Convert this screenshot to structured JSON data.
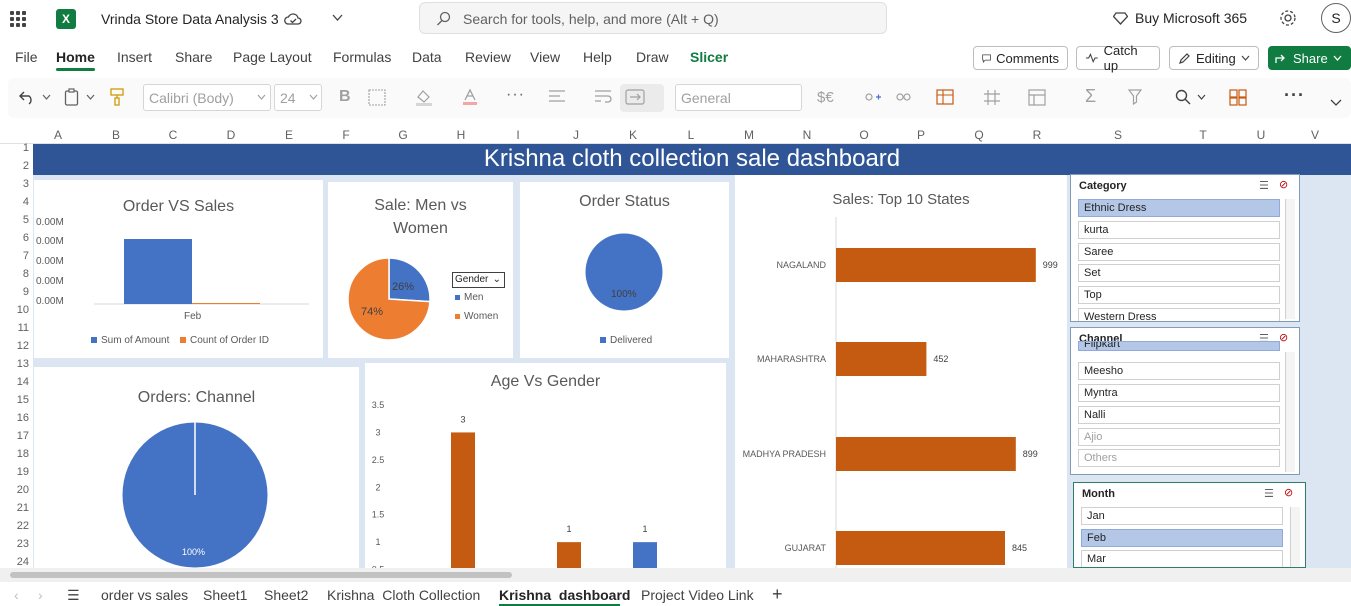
{
  "app": {
    "doc_title": "Vrinda Store Data Analysis 3",
    "search_placeholder": "Search for tools, help, and more (Alt + Q)",
    "buy_label": "Buy Microsoft 365",
    "avatar_initial": "S",
    "brand_color": "#107c41"
  },
  "menu": {
    "items": [
      "File",
      "Home",
      "Insert",
      "Share",
      "Page Layout",
      "Formulas",
      "Data",
      "Review",
      "View",
      "Help",
      "Draw",
      "Slicer"
    ],
    "active": "Home",
    "comments_label": "Comments",
    "catchup_label": "Catch up",
    "editing_label": "Editing",
    "share_label": "Share"
  },
  "ribbon": {
    "font_name": "Calibri (Body)",
    "font_size": "24",
    "number_format": "General"
  },
  "columns": [
    "A",
    "B",
    "C",
    "D",
    "E",
    "F",
    "G",
    "H",
    "I",
    "J",
    "K",
    "L",
    "M",
    "N",
    "O",
    "P",
    "Q",
    "R",
    "S",
    "T",
    "U",
    "V"
  ],
  "rows": [
    "1",
    "2",
    "3",
    "4",
    "5",
    "6",
    "7",
    "8",
    "9",
    "10",
    "11",
    "12",
    "13",
    "14",
    "15",
    "16",
    "17",
    "18",
    "19",
    "20",
    "21",
    "22",
    "23",
    "24"
  ],
  "dashboard": {
    "title": "Krishna cloth collection sale dashboard",
    "banner_color": "#2f5597"
  },
  "chart_data": [
    {
      "type": "bar",
      "title": "Order VS Sales",
      "categories": [
        "Feb"
      ],
      "series": [
        {
          "name": "Sum of Amount",
          "values": [
            0.0
          ],
          "color": "#4472c4"
        },
        {
          "name": "Count of Order ID",
          "values": [
            0.0
          ],
          "color": "#ed7d31"
        }
      ],
      "ytick_labels": [
        "0.00M",
        "0.00M",
        "0.00M",
        "0.00M",
        "0.00M"
      ]
    },
    {
      "type": "pie",
      "title": "Sale: Men vs Women",
      "labels": [
        "Men",
        "Women"
      ],
      "values": [
        26,
        74
      ],
      "value_labels": [
        "26%",
        "74%"
      ],
      "colors": [
        "#4472c4",
        "#ed7d31"
      ],
      "filter_label": "Gender"
    },
    {
      "type": "pie",
      "title": "Order Status",
      "labels": [
        "Delivered"
      ],
      "values": [
        100
      ],
      "value_labels": [
        "100%"
      ],
      "colors": [
        "#4472c4"
      ]
    },
    {
      "type": "bar",
      "orientation": "horizontal",
      "title": "Sales: Top 10 States",
      "categories": [
        "NAGALAND",
        "MAHARASHTRA",
        "MADHYA PRADESH",
        "GUJARAT"
      ],
      "values": [
        999,
        452,
        899,
        845
      ],
      "xlim": [
        0,
        1150
      ],
      "color": "#c55a11"
    },
    {
      "type": "pie",
      "title": "Orders: Channel",
      "values": [
        100
      ],
      "value_labels": [
        "100%"
      ],
      "colors": [
        "#4472c4"
      ]
    },
    {
      "type": "bar",
      "title": "Age Vs Gender",
      "values": [
        3,
        1,
        1
      ],
      "colors": [
        "#c55a11",
        "#c55a11",
        "#4472c4"
      ],
      "ylim": [
        0,
        3.5
      ],
      "yticks": [
        "3.5",
        "3",
        "2.5",
        "2",
        "1.5",
        "1",
        "0.5"
      ]
    }
  ],
  "slicers": {
    "category": {
      "title": "Category",
      "items": [
        "Ethnic Dress",
        "kurta",
        "Saree",
        "Set",
        "Top",
        "Western Dress"
      ],
      "selected": "Ethnic Dress"
    },
    "channel": {
      "title": "Channel",
      "items": [
        "Flipkart",
        "Meesho",
        "Myntra",
        "Nalli",
        "Ajio",
        "Others"
      ],
      "dimmed": [
        "Ajio",
        "Others"
      ]
    },
    "month": {
      "title": "Month",
      "items": [
        "Jan",
        "Feb",
        "Mar"
      ],
      "selected": "Feb"
    }
  },
  "sheet_tabs": {
    "items": [
      "order vs sales",
      "Sheet1",
      "Sheet2",
      "Krishna  Cloth Collection",
      "Krishna  dashboard",
      "Project Video Link"
    ],
    "active": "Krishna  dashboard"
  }
}
